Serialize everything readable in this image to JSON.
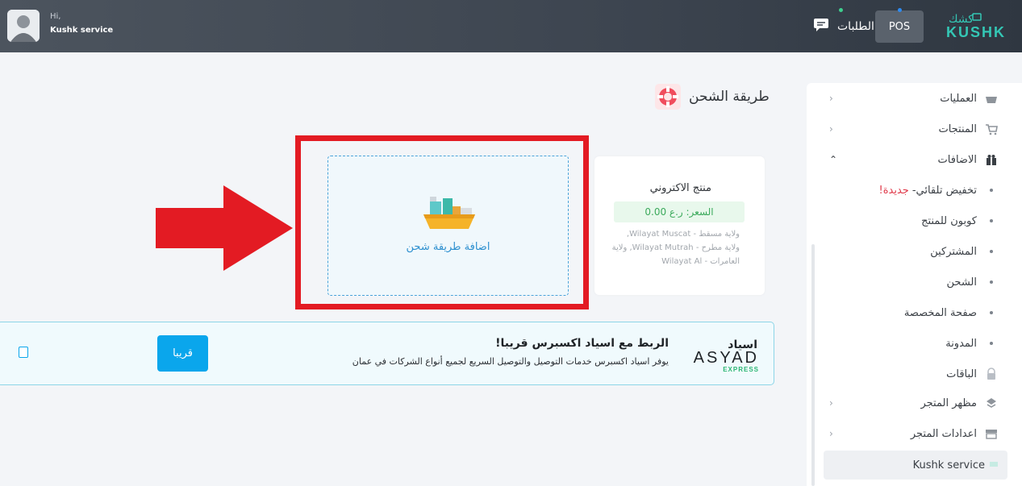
{
  "header": {
    "greeting": "Hi,",
    "user_name": "Kushk service",
    "orders_label": "الطلبات",
    "pos_label": "POS",
    "logo_text": "KUSHK",
    "logo_arabic": "كشك"
  },
  "sidebar": {
    "items": [
      {
        "label": "العمليات",
        "icon": "basket-icon",
        "chevron": "›"
      },
      {
        "label": "المنتجات",
        "icon": "cart-icon",
        "chevron": "›"
      },
      {
        "label": "الاضافات",
        "icon": "gift-icon",
        "chevron": "⌃"
      },
      {
        "label": "تخفيض تلقائي-",
        "badge": "جديدة!"
      },
      {
        "label": "كوبون للمنتج"
      },
      {
        "label": "المشتركين"
      },
      {
        "label": "الشحن"
      },
      {
        "label": "صفحة المخصصة"
      },
      {
        "label": "المدونة"
      },
      {
        "label": "الباقات",
        "icon": "lock-icon"
      },
      {
        "label": "مظهر المتجر",
        "icon": "paint-icon",
        "chevron": "›"
      },
      {
        "label": "اعدادات المتجر",
        "icon": "store-icon",
        "chevron": "›"
      }
    ],
    "footer_label": "Kushk service"
  },
  "page": {
    "title": "طريقة الشحن"
  },
  "product_card": {
    "title": "منتج الاكتروني",
    "price": "السعر: ر.ع 0.00",
    "regions": "ولاية مسقط - Wilayat Muscat, ولاية مطرح - Wilayat Mutrah, ولاية العامرات - Wilayat Al"
  },
  "add_card": {
    "label": "اضافة طريقة شحن"
  },
  "banner": {
    "title": "الربط مع اسياد اكسبرس قريبا!",
    "subtitle": "يوفر اسياد اكسبرس خدمات التوصيل والتوصيل السريع لجميع أنواع الشركات في عمان",
    "button_label": "قريبا",
    "brand_ar": "اسياد",
    "brand_en": "ASYAD",
    "brand_sub": "EXPRESS"
  },
  "colors": {
    "accent": "#0aa6ec",
    "highlight_frame": "#e31b23",
    "arrow": "#e31b23",
    "price_green": "#3caa5c",
    "logo": "#34c7b5"
  }
}
